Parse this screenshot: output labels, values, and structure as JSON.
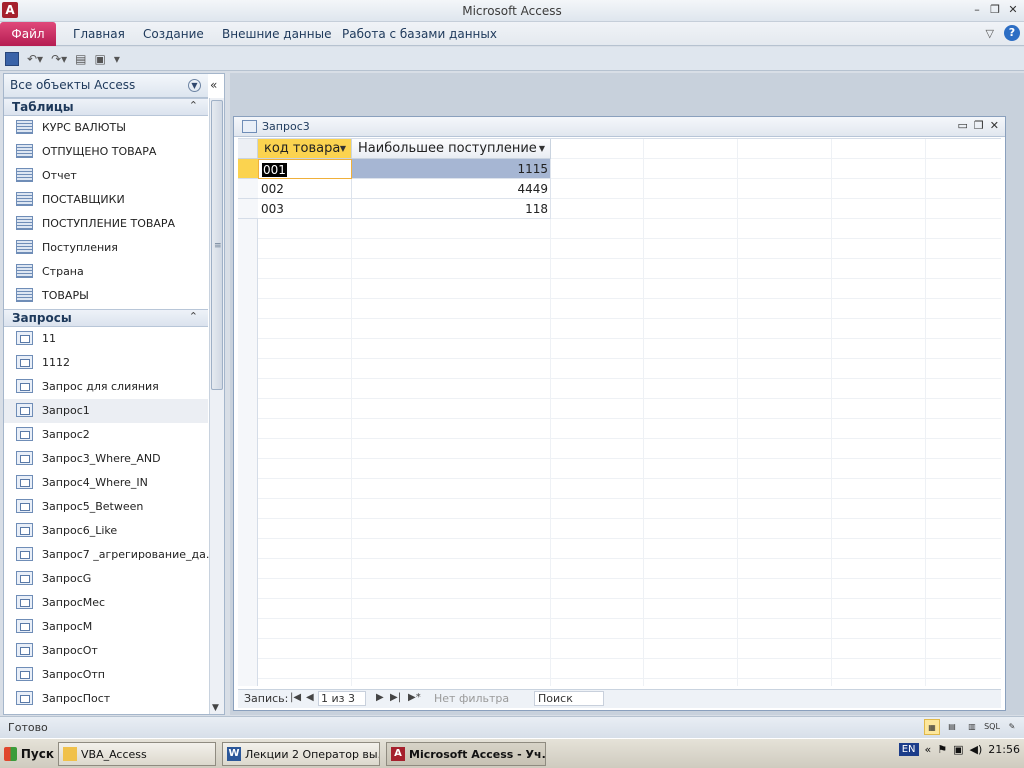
{
  "window": {
    "title": "Microsoft Access",
    "app_icon": "A"
  },
  "ribbon": {
    "file_tab": "Файл",
    "tabs": [
      "Главная",
      "Создание",
      "Внешние данные",
      "Работа с базами данных"
    ]
  },
  "nav": {
    "header": "Все объекты Access",
    "groups": [
      {
        "title": "Таблицы",
        "items": [
          "КУРС ВАЛЮТЫ",
          "ОТПУЩЕНО ТОВАРА",
          "Отчет",
          "ПОСТАВЩИКИ",
          "ПОСТУПЛЕНИЕ ТОВАРА",
          "Поступления",
          "Страна",
          "ТОВАРЫ"
        ]
      },
      {
        "title": "Запросы",
        "items": [
          "11",
          "1112",
          "Запрос для слияния",
          "Запрос1",
          "Запрос2",
          "Запрос3_Where_AND",
          "Запрос4_Where_IN",
          "Запрос5_Between",
          "Запрос6_Like",
          "Запрос7 _агрегирование_да...",
          "ЗапросG",
          "ЗапросМес",
          "ЗапросМ",
          "ЗапросОт",
          "ЗапросОтп",
          "ЗапросПост"
        ]
      }
    ],
    "selected_item": "Запрос1"
  },
  "query_window": {
    "title": "Запрос3",
    "columns": [
      "код товара",
      "Наибольшее поступление"
    ],
    "rows": [
      {
        "code": "001",
        "value": "1115"
      },
      {
        "code": "002",
        "value": "4449"
      },
      {
        "code": "003",
        "value": "118"
      }
    ]
  },
  "record_nav": {
    "label": "Запись:",
    "position": "1 из 3",
    "filter": "Нет фильтра",
    "search_placeholder": "Поиск"
  },
  "status": {
    "text": "Готово",
    "sql_label": "SQL"
  },
  "taskbar": {
    "start": "Пуск",
    "tasks": [
      "VBA_Access",
      "Лекции 2 Оператор вы...",
      "Microsoft Access - Уч..."
    ],
    "lang": "EN",
    "time": "21:56"
  }
}
